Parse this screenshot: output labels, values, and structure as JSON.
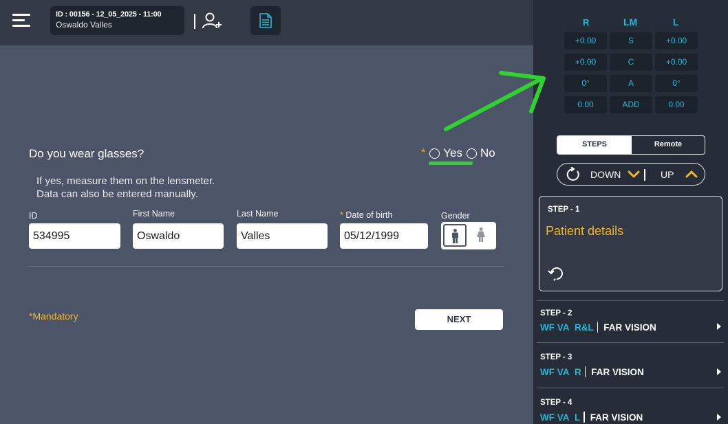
{
  "header": {
    "patient_id_line": "ID : 00156 - 12_05_2025 - 11:00",
    "patient_name": "Oswaldo Valles"
  },
  "form": {
    "question": "Do you wear glasses?",
    "required_mark": "*",
    "option_yes": "Yes",
    "option_no": "No",
    "hint_line1": "If yes, measure them on the lensmeter.",
    "hint_line2": "Data can also be entered manually.",
    "labels": {
      "id": "ID",
      "first_name": "First Name",
      "last_name": "Last Name",
      "dob_required": "*",
      "dob": "Date of birth",
      "gender": "Gender"
    },
    "values": {
      "id": "534995",
      "first_name": "Oswaldo",
      "last_name": "Valles",
      "dob": "05/12/1999"
    },
    "gender_selected": "male",
    "mandatory_note": "*Mandatory",
    "next_label": "NEXT"
  },
  "lensmeter": {
    "col_r": "R",
    "col_lm": "LM",
    "col_l": "L",
    "rows": [
      {
        "r": "+0.00",
        "label": "S",
        "l": "+0.00"
      },
      {
        "r": "+0.00",
        "label": "C",
        "l": "+0.00"
      },
      {
        "r": "0°",
        "label": "A",
        "l": "0°"
      },
      {
        "r": "0.00",
        "label": "ADD",
        "l": "0.00"
      }
    ]
  },
  "panel": {
    "tab_steps": "STEPS",
    "tab_remote": "Remote",
    "down_label": "DOWN",
    "up_label": "UP",
    "current_step": {
      "number": "STEP - 1",
      "title": "Patient details"
    },
    "steps": [
      {
        "number": "STEP - 2",
        "test": "WF VA",
        "eye": "R&L",
        "mode": "FAR VISION"
      },
      {
        "number": "STEP - 3",
        "test": "WF VA",
        "eye": "R",
        "mode": "FAR VISION"
      },
      {
        "number": "STEP - 4",
        "test": "WF VA",
        "eye": "L",
        "mode": "FAR VISION"
      }
    ]
  },
  "colors": {
    "accent_yellow": "#f0b629",
    "accent_cyan": "#29b6d4",
    "annotation_green": "#2fd22f"
  }
}
